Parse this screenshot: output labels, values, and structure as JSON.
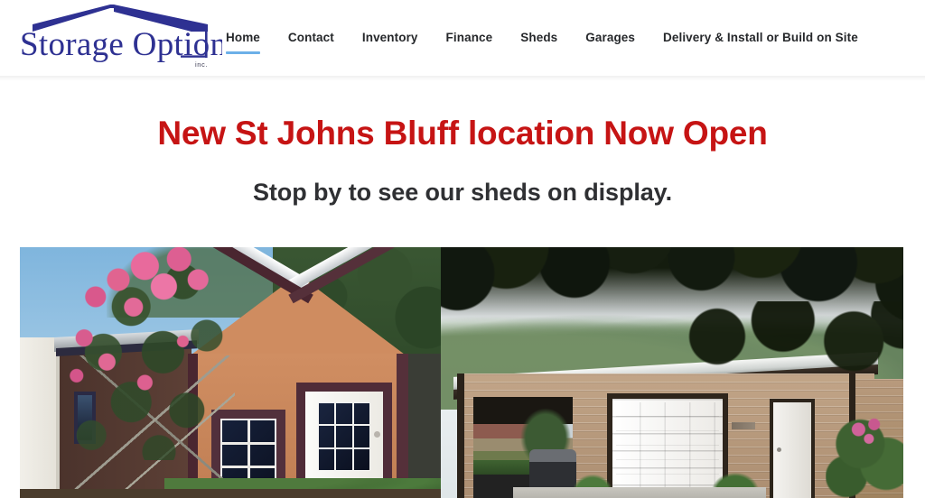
{
  "header": {
    "logo": {
      "name": "storage-options-logo",
      "line1": "Storage",
      "line2": "Options",
      "suffix": "inc.",
      "brand_color": "#2e3192",
      "alt": "Storage Options Inc. logo with house roof graphic"
    },
    "nav": {
      "items": [
        {
          "label": "Home",
          "active": true
        },
        {
          "label": "Contact",
          "active": false
        },
        {
          "label": "Inventory",
          "active": false
        },
        {
          "label": "Finance",
          "active": false
        },
        {
          "label": "Sheds",
          "active": false
        },
        {
          "label": "Garages",
          "active": false
        },
        {
          "label": "Delivery & Install or Build on Site",
          "active": false
        }
      ],
      "active_underline_color": "#6cb0e8",
      "text_color": "#26282b"
    }
  },
  "hero": {
    "title": "New St Johns Bluff location Now Open",
    "title_color": "#c61414",
    "subtitle": "Stop by to see our sheds on display.",
    "subtitle_color": "#2f3033"
  },
  "gallery": {
    "photos": [
      {
        "name": "shed-photo",
        "alt": "Tan portable storage shed with brown trim, white nine-pane door, gabled metal roof and a blooming pink crepe myrtle tree in front"
      },
      {
        "name": "garage-photo",
        "alt": "Tan metal garage with white roll-up garage door, white walk-in side door and open carport bay under a large shade tree"
      }
    ]
  }
}
